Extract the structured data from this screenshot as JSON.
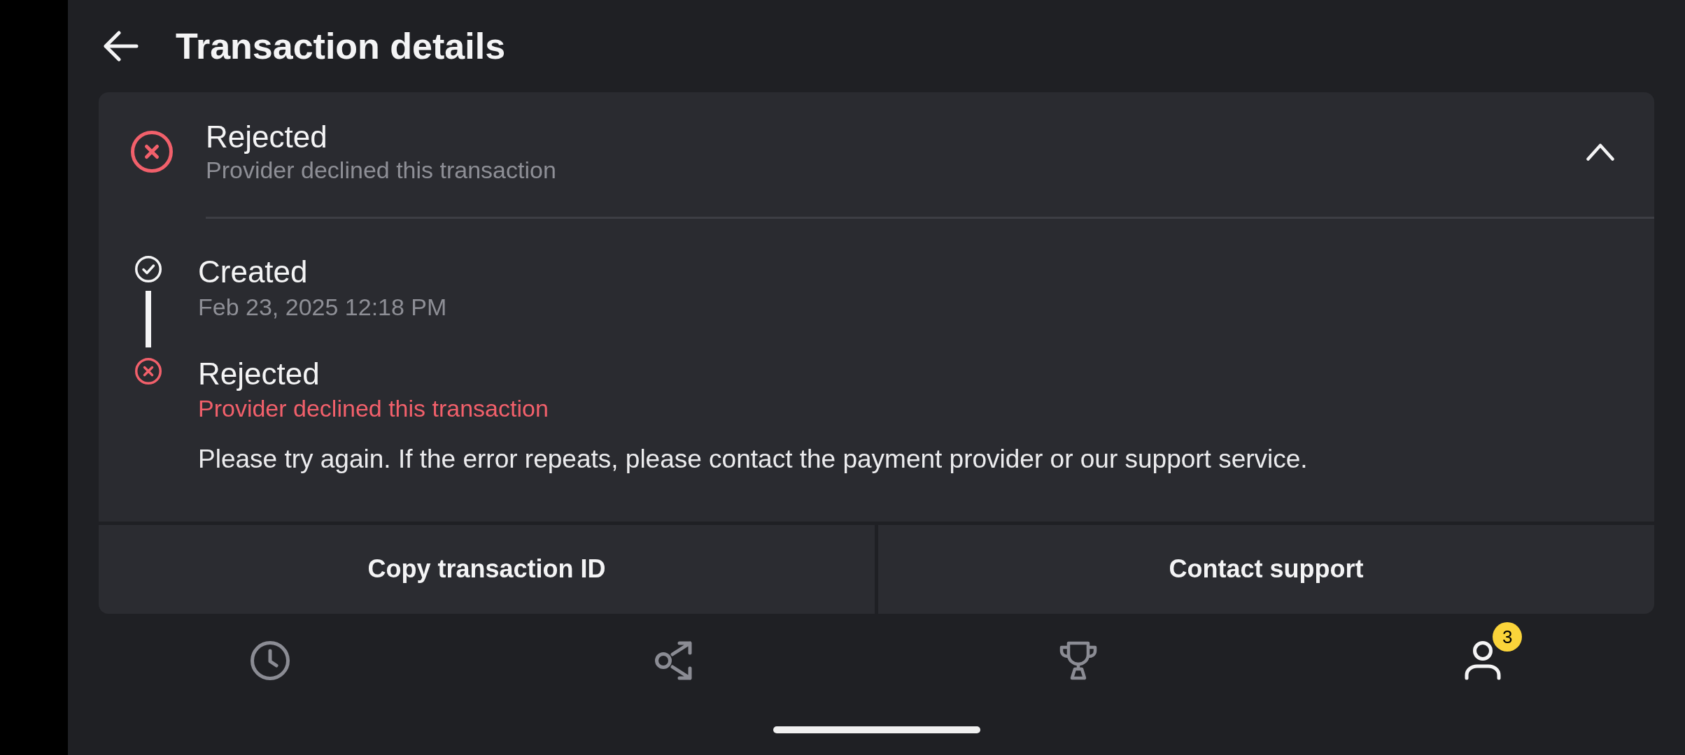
{
  "header": {
    "title": "Transaction details"
  },
  "status": {
    "kind": "rejected",
    "title": "Rejected",
    "subtitle": "Provider declined this transaction",
    "expanded": true
  },
  "timeline": [
    {
      "kind": "done",
      "title": "Created",
      "detail": "Feb 23, 2025 12:18 PM"
    },
    {
      "kind": "rejected",
      "title": "Rejected",
      "detail": "Provider declined this transaction",
      "note": "Please try again. If the error repeats, please contact the payment provider or our support service."
    }
  ],
  "actions": [
    "Copy transaction ID",
    "Contact support"
  ],
  "nav": [
    {
      "kind": "history",
      "selected": false
    },
    {
      "kind": "transfer",
      "selected": false
    },
    {
      "kind": "trophy",
      "selected": false
    },
    {
      "kind": "profile",
      "selected": true,
      "badge": "3"
    }
  ]
}
